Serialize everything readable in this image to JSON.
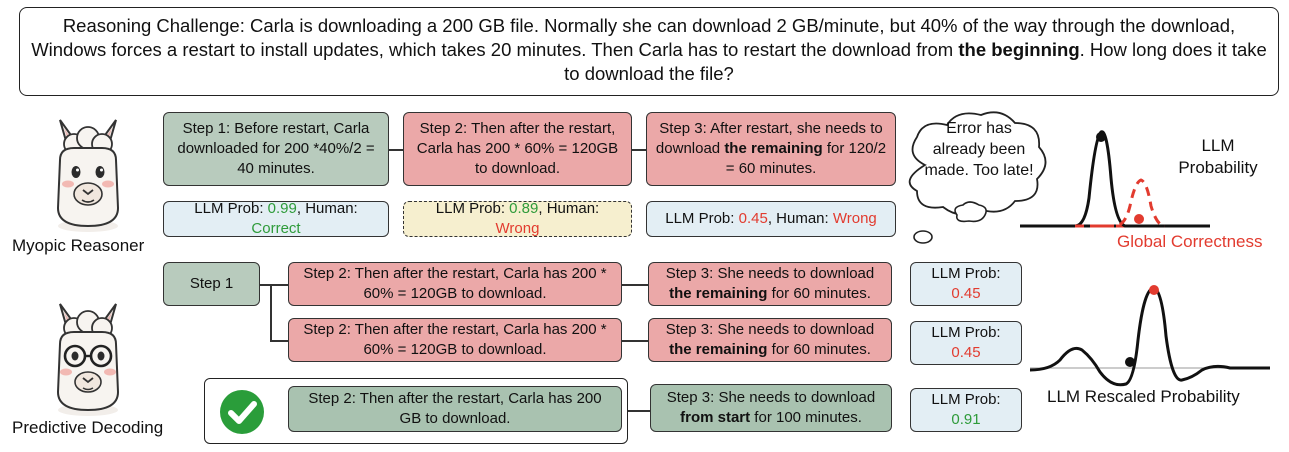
{
  "question": {
    "prefix": "Reasoning Challenge: Carla is downloading a 200 GB file. Normally she can download 2 GB/minute, but 40% of the way through the download, Windows forces a restart to install updates, which takes 20 minutes. Then Carla has to restart the download from ",
    "bold": "the beginning",
    "suffix": ". How long does it take to download the file?"
  },
  "myopic": {
    "label": "Myopic Reasoner",
    "steps": [
      {
        "text": "Step 1: Before restart, Carla downloaded for 200 *40%/2 = 40 minutes."
      },
      {
        "text": "Step 2: Then after the restart, Carla has 200 * 60% = 120GB to download."
      },
      {
        "pre": "Step 3: After restart, she needs to download ",
        "bold": "the remaining",
        "post": " for 120/2 = 60 minutes."
      }
    ],
    "probs": [
      {
        "prefix": "LLM Prob: ",
        "value": "0.99",
        "sep": ", Human: ",
        "human": "Correct"
      },
      {
        "prefix": "LLM Prob: ",
        "value": "0.89",
        "sep": ", Human: ",
        "human": "Wrong"
      },
      {
        "prefix": "LLM Prob: ",
        "value": "0.45",
        "sep": ", Human: ",
        "human": "Wrong"
      }
    ],
    "thought": "Error has already been made. Too late!"
  },
  "predictive": {
    "label": "Predictive Decoding",
    "step1": "Step 1",
    "rows": [
      {
        "step2": "Step 2:  Then after the restart, Carla has 200 * 60% = 120GB to download.",
        "step3_pre": "Step 3: She needs to download ",
        "step3_bold": "the remaining",
        "step3_post": " for 60 minutes.",
        "prob_prefix": "LLM Prob: ",
        "prob": "0.45"
      },
      {
        "step2": "Step 2:  Then after the restart, Carla has 200 * 60% = 120GB to download.",
        "step3_pre": "Step 3: She needs to download ",
        "step3_bold": "the remaining",
        "step3_post": " for 60 minutes.",
        "prob_prefix": "LLM Prob: ",
        "prob": "0.45"
      },
      {
        "step2": "Step 2:  Then after the restart, Carla has 200 GB to download.",
        "step3_pre": "Step 3: She needs to download ",
        "step3_bold": "from start",
        "step3_post": " for 100 minutes.",
        "prob_prefix": "LLM Prob: ",
        "prob": "0.91"
      }
    ]
  },
  "plots": {
    "top_label": "LLM Probability",
    "top_sublabel": "Global Correctness",
    "bottom_label": "LLM Rescaled Probability"
  },
  "colors": {
    "correct": "#2e9b3a",
    "wrong": "#e23b2f",
    "step_green": "#b8cbbd",
    "step_red": "#eba8a8",
    "prob_blue": "#e3eef4",
    "checkmark": "#2a9d3a"
  }
}
